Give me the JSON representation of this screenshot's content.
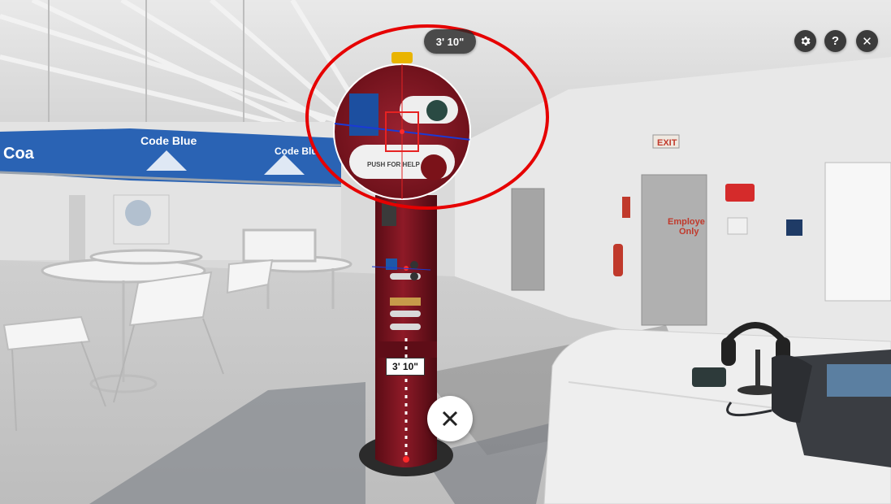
{
  "measurement": {
    "top_value": "3' 10\"",
    "line_value": "3' 10\""
  },
  "scene_text": {
    "banner_1": "Code Blue",
    "banner_2": "Code Blu",
    "banner_left": "Coa",
    "exit_sign": "EXIT",
    "door_sign_1": "Employe",
    "door_sign_2": "Only",
    "callbox_label": "PUSH FOR HELP"
  },
  "controls": {
    "help_glyph": "?",
    "close_glyph": "✕",
    "settings_icon": "gear-icon",
    "close_measure_icon": "close-icon"
  },
  "colors": {
    "annotation": "#e60000",
    "callbox": "#7d1420",
    "banner": "#2a63b4"
  }
}
